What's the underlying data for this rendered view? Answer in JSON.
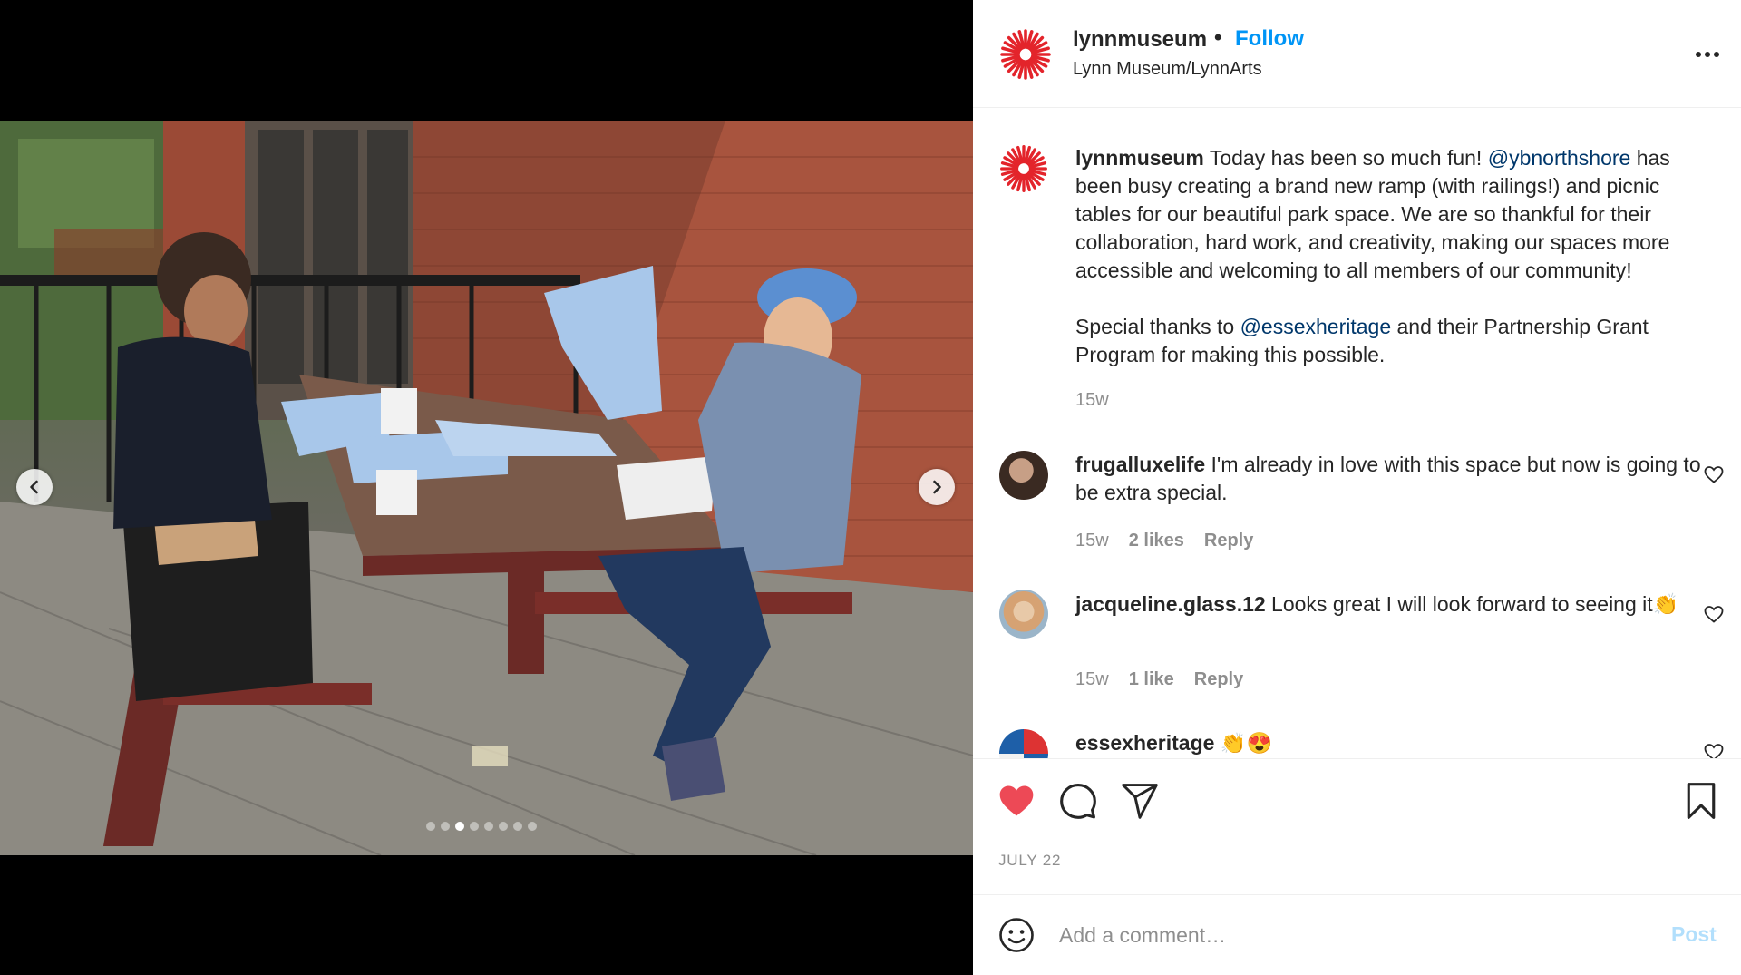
{
  "post": {
    "username": "lynnmuseum",
    "separator": "•",
    "follow_label": "Follow",
    "location": "Lynn Museum/LynnArts",
    "more_icon": "more-horizontal-icon"
  },
  "caption": {
    "username": "lynnmuseum",
    "text_1": " Today has been so much fun! ",
    "mention_1": "@ybnorthshore",
    "text_2": " has been busy creating a brand new ramp (with railings!) and picnic tables for our beautiful park space. We are so thankful for their collaboration, hard work, and creativity, making our spaces more accessible and welcoming to all members of our community!",
    "text_3": "Special thanks to ",
    "mention_2": "@essexheritage",
    "text_4": " and their Partnership Grant Program for making this possible.",
    "time": "15w"
  },
  "comments": [
    {
      "username": "frugalluxelife",
      "text": " I'm already in love with this space but now is going to be extra special.",
      "time": "15w",
      "likes": "2 likes",
      "reply": "Reply"
    },
    {
      "username": "jacqueline.glass.12",
      "text": " Looks great I will look forward to seeing it👏",
      "time": "15w",
      "likes": "1 like",
      "reply": "Reply"
    },
    {
      "username": "essexheritage",
      "text": " 👏😍"
    }
  ],
  "actions": {
    "date": "JULY 22",
    "liked": true,
    "like_color": "#ed4956"
  },
  "add_comment": {
    "placeholder": "Add a comment…",
    "post_label": "Post"
  },
  "carousel": {
    "total_slides": 8,
    "active_slide": 3
  },
  "colors": {
    "brand_red": "#e3242b",
    "link_blue": "#0095f6",
    "mention_blue": "#00376b"
  }
}
